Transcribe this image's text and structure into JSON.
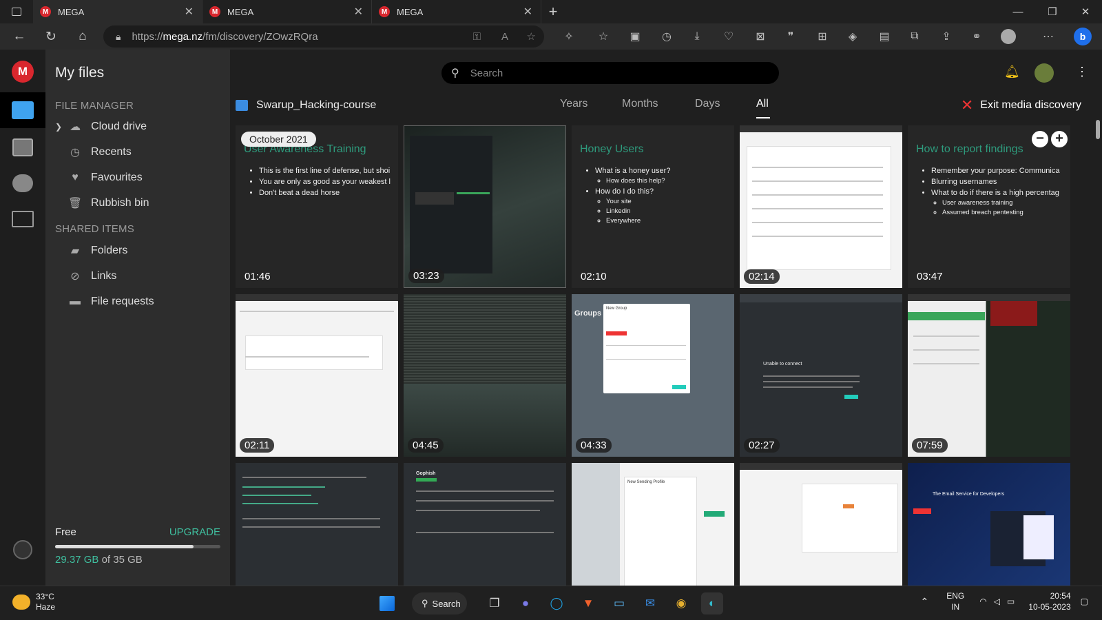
{
  "browser": {
    "tabs": [
      {
        "label": "MEGA"
      },
      {
        "label": "MEGA"
      },
      {
        "label": "MEGA"
      }
    ],
    "url_prefix": "https://",
    "url_host": "mega.nz",
    "url_path": "/fm/discovery/ZOwzRQra"
  },
  "sidebar": {
    "title": "My files",
    "file_manager_heading": "FILE MANAGER",
    "file_manager_items": [
      {
        "label": "Cloud drive",
        "icon": "cloud-icon"
      },
      {
        "label": "Recents",
        "icon": "clock-icon"
      },
      {
        "label": "Favourites",
        "icon": "heart-icon"
      },
      {
        "label": "Rubbish bin",
        "icon": "trash-icon"
      }
    ],
    "shared_heading": "SHARED ITEMS",
    "shared_items": [
      {
        "label": "Folders",
        "icon": "shared-folder-icon"
      },
      {
        "label": "Links",
        "icon": "link-icon"
      },
      {
        "label": "File requests",
        "icon": "file-request-icon"
      }
    ],
    "storage": {
      "plan": "Free",
      "upgrade_label": "UPGRADE",
      "used": "29.37 GB",
      "of_text": "of 35 GB",
      "used_fraction": 0.839
    }
  },
  "main": {
    "search_placeholder": "Search",
    "folder_name": "Swarup_Hacking-course",
    "view_tabs": [
      "Years",
      "Months",
      "Days",
      "All"
    ],
    "active_view_tab": "All",
    "exit_label": "Exit media discovery",
    "date_pill": "October 2021",
    "tiles": [
      {
        "duration": "01:46",
        "slide_title": "User Awareness Training",
        "bullets": [
          "This is the first line of defense, but shoi",
          "You are only as good as your weakest l",
          "Don't beat a dead horse"
        ]
      },
      {
        "duration": "03:23"
      },
      {
        "duration": "02:10",
        "slide_title": "Honey Users",
        "bullets": [
          "What is a honey user?",
          "How do I do this?"
        ],
        "sub1": [
          "How does this help?"
        ],
        "sub2": [
          "Your site",
          "Linkedin",
          "Everywhere"
        ]
      },
      {
        "duration": "02:14"
      },
      {
        "duration": "03:47",
        "slide_title": "How to report findings",
        "bullets": [
          "Remember your purpose: Communica",
          "Blurring usernames",
          "What to do if there is a high percentag"
        ],
        "sub3": [
          "User awareness training",
          "Assumed breach pentesting"
        ]
      },
      {
        "duration": "02:11"
      },
      {
        "duration": "04:45"
      },
      {
        "duration": "04:33",
        "caption": "Groups",
        "dialog_title": "New Group"
      },
      {
        "duration": "02:27",
        "caption": "Unable to connect"
      },
      {
        "duration": "07:59"
      },
      {},
      {
        "caption": "Gophish"
      },
      {
        "dialog_title": "New Sending Profile"
      },
      {},
      {
        "caption": "The Email Service for Developers"
      }
    ]
  },
  "taskbar": {
    "temperature": "33°C",
    "weather": "Haze",
    "search_label": "Search",
    "lang": "ENG",
    "region": "IN",
    "time": "20:54",
    "date": "10-05-2023"
  },
  "colors": {
    "mega_red": "#d9272e",
    "accent_green": "#3fbf9f",
    "slide_title_green": "#2e9b7d"
  }
}
